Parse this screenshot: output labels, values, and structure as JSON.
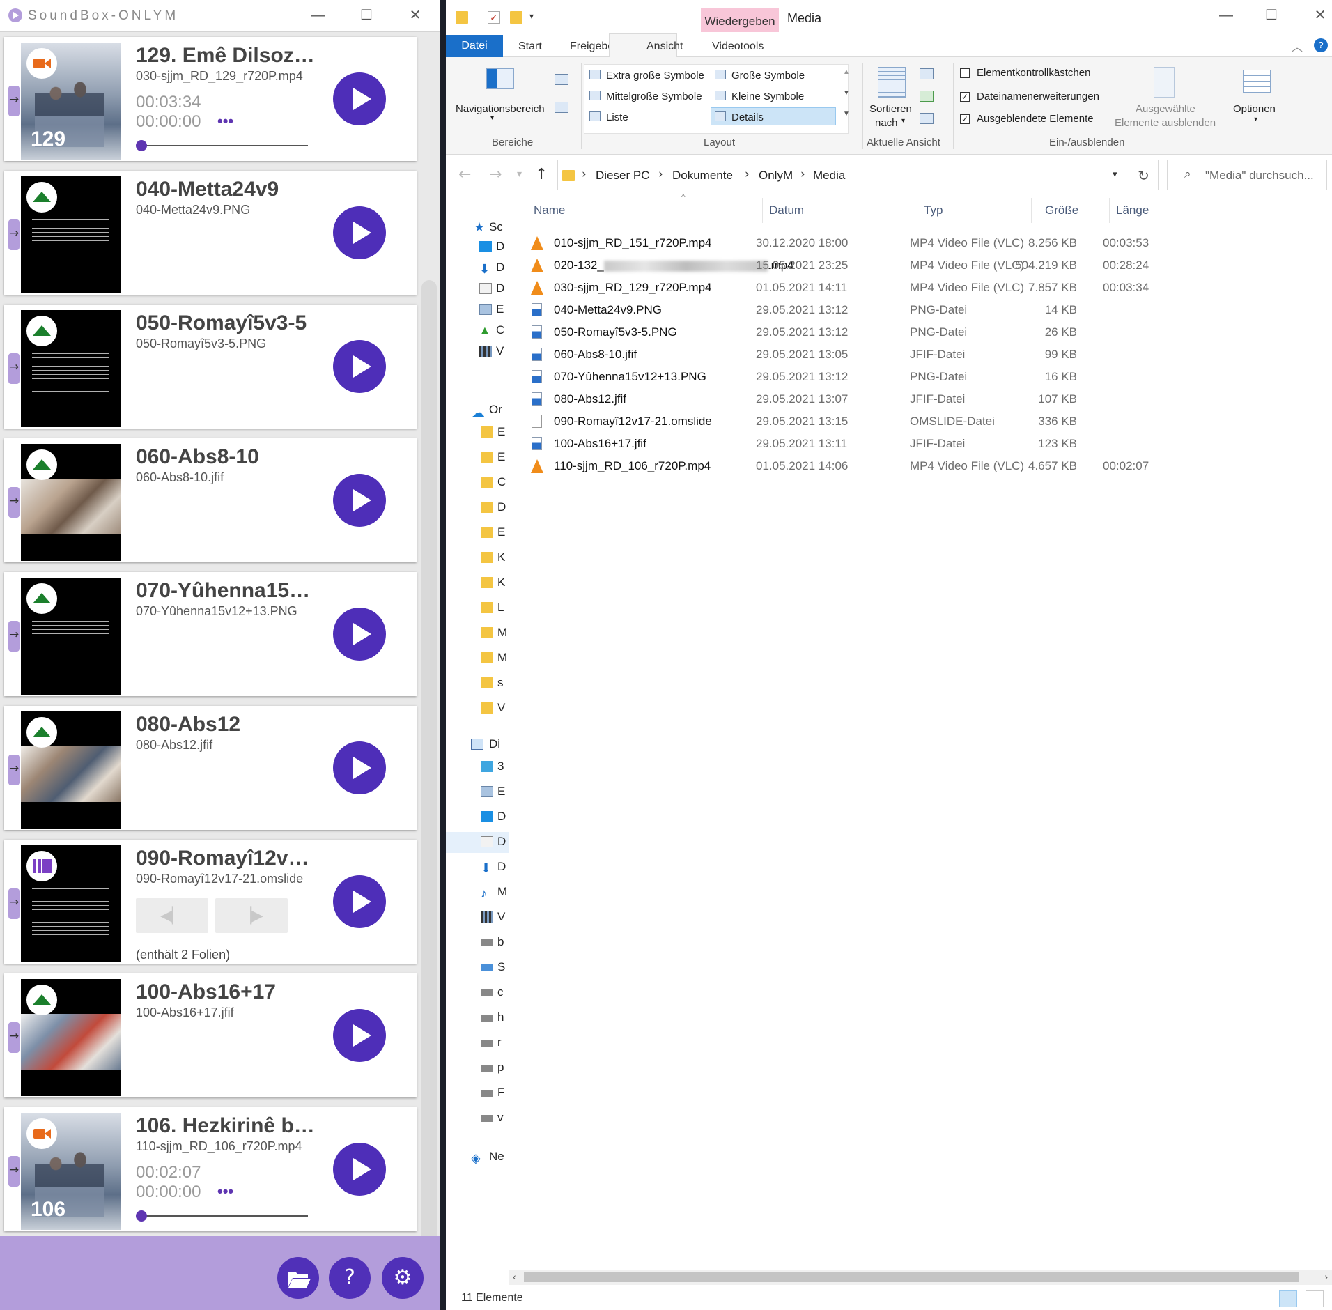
{
  "soundbox": {
    "title": "SoundBox-ONLYM",
    "items": [
      {
        "title": "129. Emê Dilsoz…",
        "file": "030-sjjm_RD_129_r720P.mp4",
        "duration": "00:03:34",
        "position": "00:00:00",
        "thumb_number": "129",
        "kind": "video"
      },
      {
        "title": "040-Metta24v9",
        "file": "040-Metta24v9.PNG",
        "kind": "image"
      },
      {
        "title": "050-Romayî5v3-5",
        "file": "050-Romayî5v3-5.PNG",
        "kind": "image"
      },
      {
        "title": "060-Abs8-10",
        "file": "060-Abs8-10.jfif",
        "kind": "image"
      },
      {
        "title": "070-Yûhenna15…",
        "file": "070-Yûhenna15v12+13.PNG",
        "kind": "image"
      },
      {
        "title": "080-Abs12",
        "file": "080-Abs12.jfif",
        "kind": "image"
      },
      {
        "title": "090-Romayî12v…",
        "file": "090-Romayî12v17-21.omslide",
        "kind": "slideshow",
        "contains": "(enthält 2 Folien)"
      },
      {
        "title": "100-Abs16+17",
        "file": "100-Abs16+17.jfif",
        "kind": "image"
      },
      {
        "title": "106. Hezkirinê b…",
        "file": "110-sjjm_RD_106_r720P.mp4",
        "duration": "00:02:07",
        "position": "00:00:00",
        "thumb_number": "106",
        "kind": "video"
      }
    ],
    "more_label": "•••",
    "footer_icons": [
      "folder-open-icon",
      "help-icon",
      "settings-gear-icon"
    ],
    "accent_color": "#4e2eb8",
    "footer_color": "#b39ddb"
  },
  "explorer": {
    "context_tab": "Wiedergeben",
    "window_title": "Media",
    "tabs": [
      "Datei",
      "Start",
      "Freigeben",
      "Ansicht",
      "Videotools"
    ],
    "ribbon": {
      "panes": {
        "nav_label": "Navigationsbereich",
        "group": "Bereiche"
      },
      "layout": {
        "items": [
          "Extra große Symbole",
          "Große Symbole",
          "Mittelgroße Symbole",
          "Kleine Symbole",
          "Liste",
          "Details"
        ],
        "group": "Layout"
      },
      "current_view": {
        "sort_line1": "Sortieren",
        "sort_line2": "nach",
        "group": "Aktuelle Ansicht"
      },
      "show_hide": {
        "checkbox1": "Elementkontrollkästchen",
        "checkbox2": "Dateinamenerweiterungen",
        "checkbox3": "Ausgeblendete Elemente",
        "hide_line1": "Ausgewählte",
        "hide_line2": "Elemente ausblenden",
        "group": "Ein-/ausblenden"
      },
      "options": "Optionen"
    },
    "breadcrumb": [
      "Dieser PC",
      "Dokumente",
      "OnlyM",
      "Media"
    ],
    "search_placeholder": "\"Media\" durchsuch...",
    "nav": {
      "quick_access": "Sc",
      "onedrive": "Or",
      "this_pc": "Di",
      "network": "Ne",
      "letters": [
        "D",
        "D",
        "D",
        "E",
        "C",
        "V",
        "E",
        "E",
        "C",
        "D",
        "E",
        "K",
        "K",
        "L",
        "M",
        "M",
        "s",
        "V",
        "3",
        "E",
        "D",
        "D",
        "D",
        "M",
        "V",
        "b",
        "S",
        "c",
        "h",
        "r",
        "p",
        "F",
        "v"
      ]
    },
    "columns": {
      "name": "Name",
      "date": "Datum",
      "type": "Typ",
      "size": "Größe",
      "length": "Länge"
    },
    "files": [
      {
        "name": "010-sjjm_RD_151_r720P.mp4",
        "date": "30.12.2020 18:00",
        "type": "MP4 Video File (VLC)",
        "size": "8.256 KB",
        "length": "00:03:53",
        "icon": "vlc-icon"
      },
      {
        "name_prefix": "020-132_",
        "name_suffix": ".mp4",
        "date": "15.05.2021 23:25",
        "type": "MP4 Video File (VLC)",
        "size": "504.219 KB",
        "length": "00:28:24",
        "icon": "vlc-icon"
      },
      {
        "name": "030-sjjm_RD_129_r720P.mp4",
        "date": "01.05.2021 14:11",
        "type": "MP4 Video File (VLC)",
        "size": "7.857 KB",
        "length": "00:03:34",
        "icon": "vlc-icon"
      },
      {
        "name": "040-Metta24v9.PNG",
        "date": "29.05.2021 13:12",
        "type": "PNG-Datei",
        "size": "14 KB",
        "length": "",
        "icon": "image-file-icon"
      },
      {
        "name": "050-Romayî5v3-5.PNG",
        "date": "29.05.2021 13:12",
        "type": "PNG-Datei",
        "size": "26 KB",
        "length": "",
        "icon": "image-file-icon"
      },
      {
        "name": "060-Abs8-10.jfif",
        "date": "29.05.2021 13:05",
        "type": "JFIF-Datei",
        "size": "99 KB",
        "length": "",
        "icon": "image-file-icon"
      },
      {
        "name": "070-Yûhenna15v12+13.PNG",
        "date": "29.05.2021 13:12",
        "type": "PNG-Datei",
        "size": "16 KB",
        "length": "",
        "icon": "image-file-icon"
      },
      {
        "name": "080-Abs12.jfif",
        "date": "29.05.2021 13:07",
        "type": "JFIF-Datei",
        "size": "107 KB",
        "length": "",
        "icon": "image-file-icon"
      },
      {
        "name": "090-Romayî12v17-21.omslide",
        "date": "29.05.2021 13:15",
        "type": "OMSLIDE-Datei",
        "size": "336 KB",
        "length": "",
        "icon": "blank-file-icon"
      },
      {
        "name": "100-Abs16+17.jfif",
        "date": "29.05.2021 13:11",
        "type": "JFIF-Datei",
        "size": "123 KB",
        "length": "",
        "icon": "image-file-icon"
      },
      {
        "name": "110-sjjm_RD_106_r720P.mp4",
        "date": "01.05.2021 14:06",
        "type": "MP4 Video File (VLC)",
        "size": "4.657 KB",
        "length": "00:02:07",
        "icon": "vlc-icon"
      }
    ],
    "status": "11 Elemente",
    "accent_color": "#1a6fc9"
  }
}
